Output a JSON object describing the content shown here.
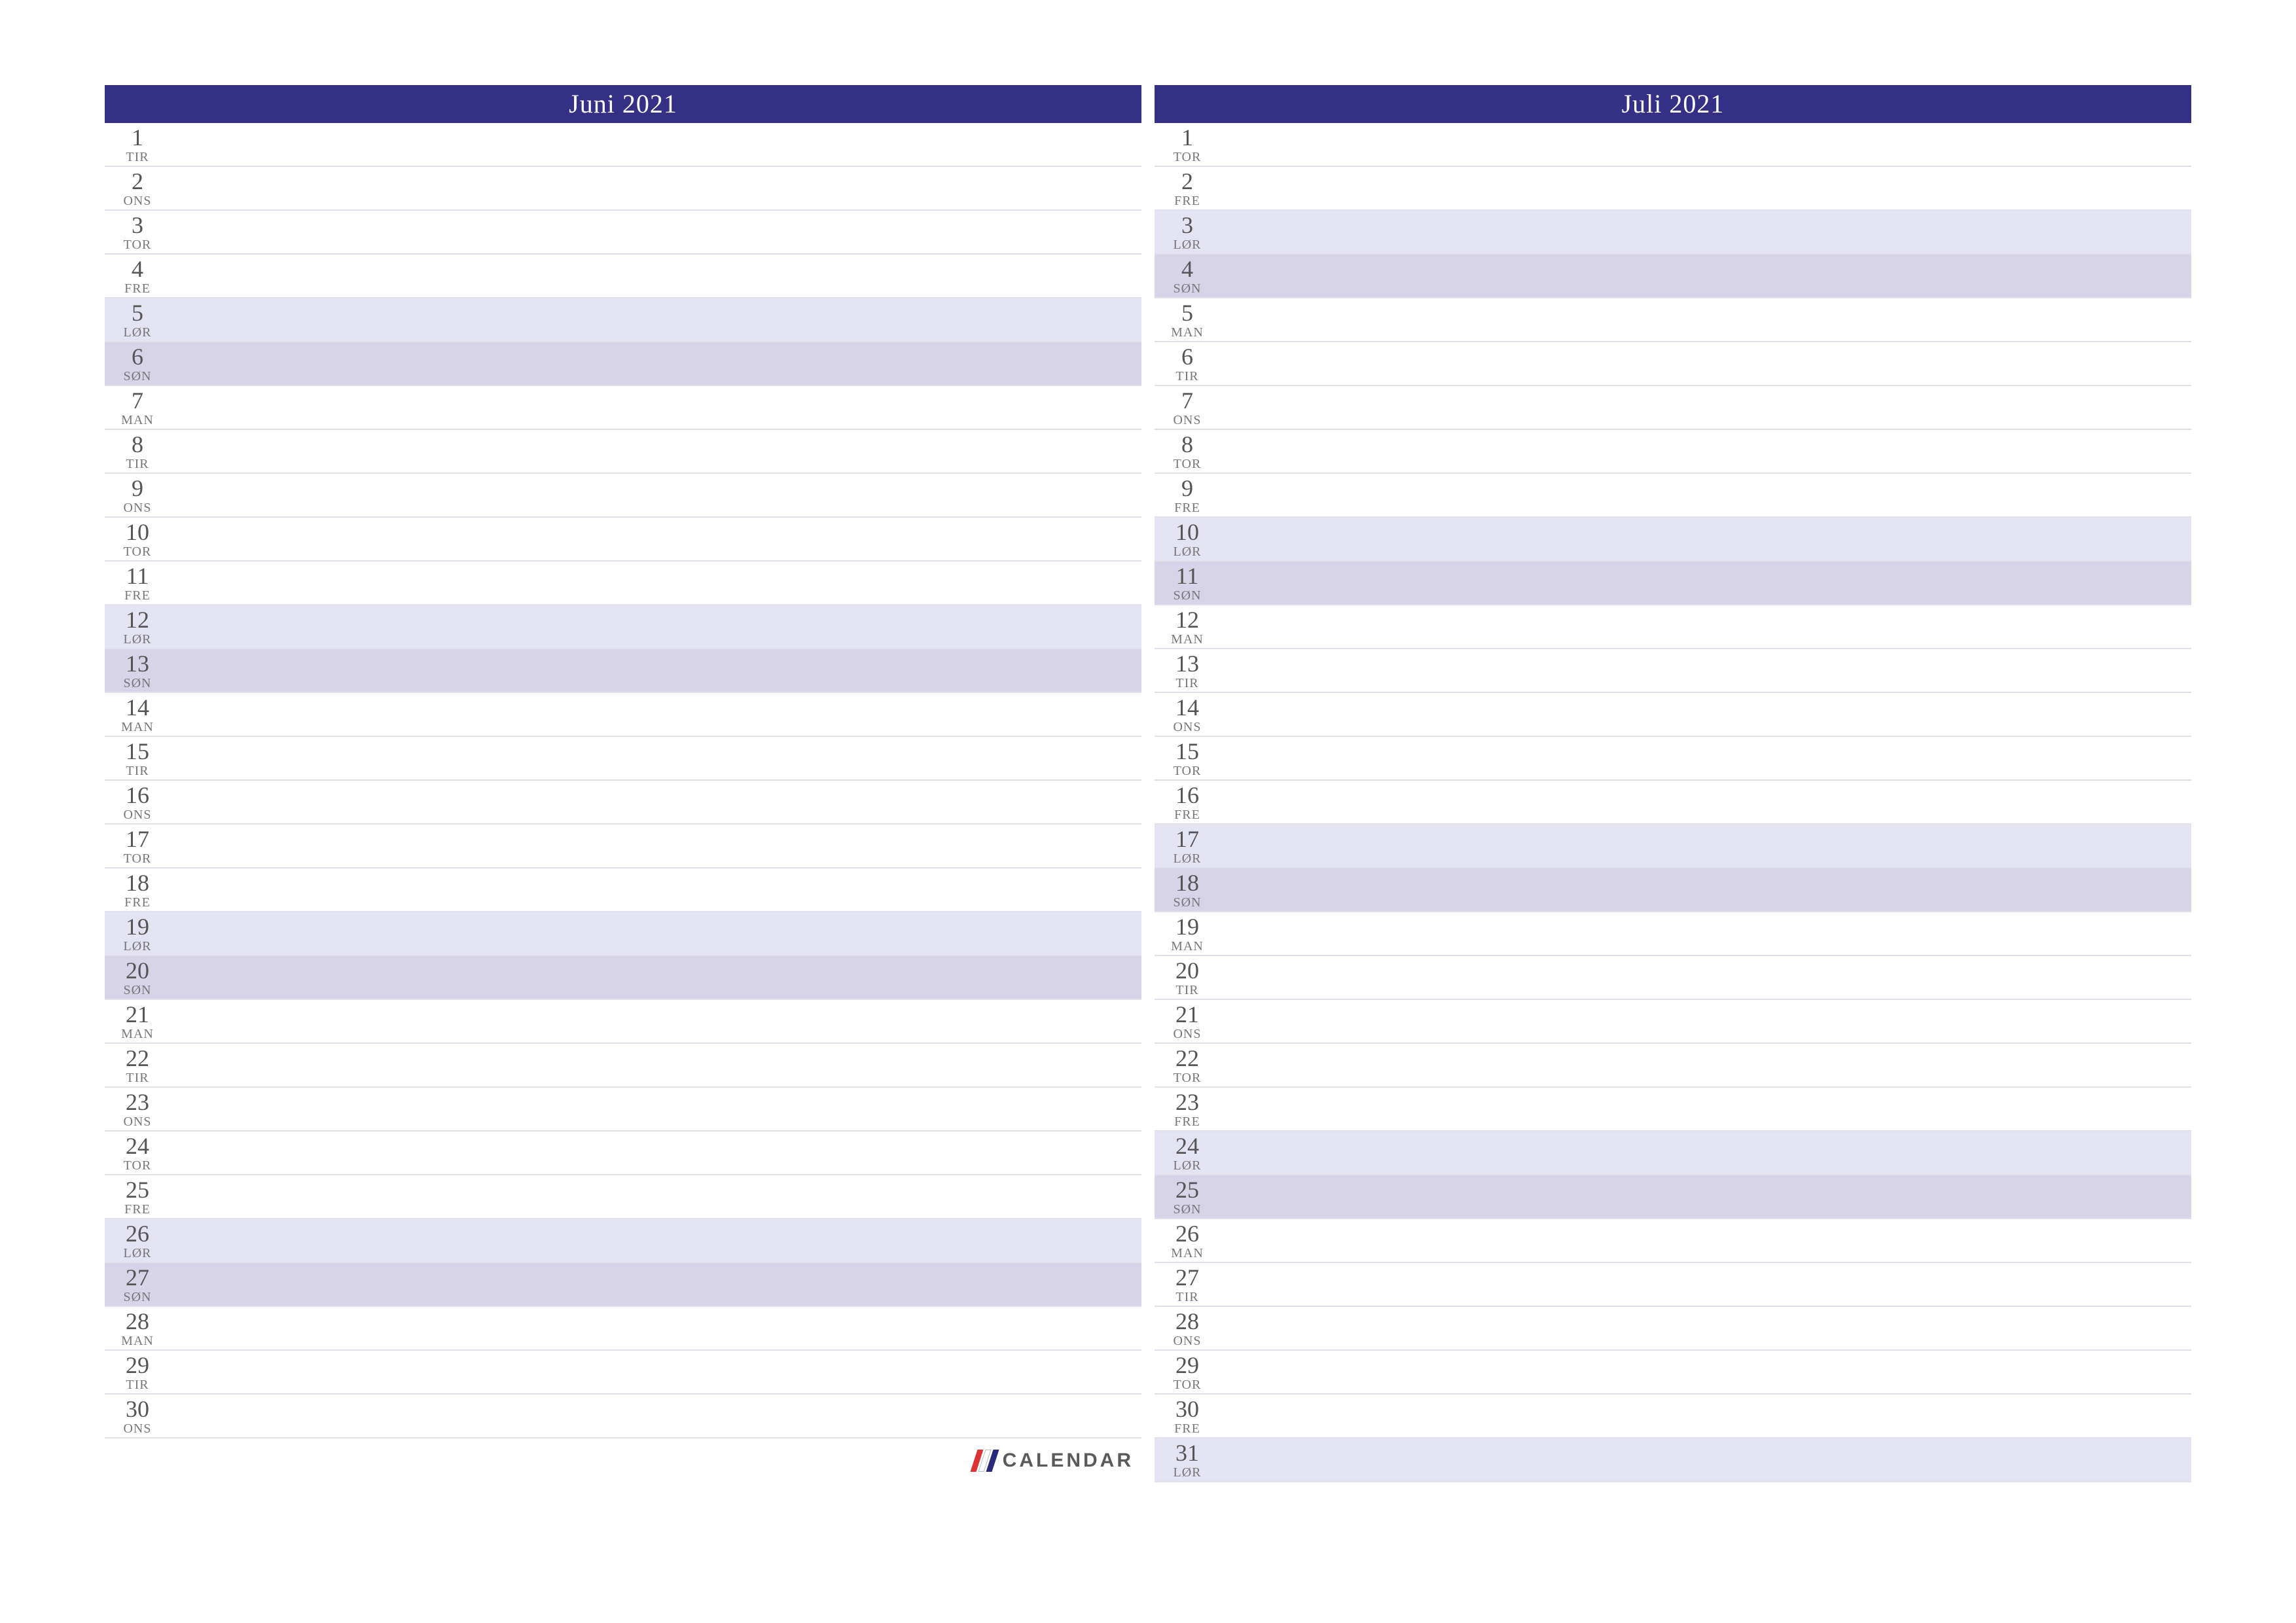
{
  "brand": "CALENDAR",
  "weekday_bg": {
    "MAN": "bg-weekday",
    "TIR": "bg-weekday",
    "ONS": "bg-weekday",
    "TOR": "bg-weekday",
    "FRE": "bg-weekday",
    "LØR": "bg-sat",
    "SØN": "bg-sun"
  },
  "months": [
    {
      "title": "Juni 2021",
      "show_brand": true,
      "days": [
        {
          "n": "1",
          "w": "TIR"
        },
        {
          "n": "2",
          "w": "ONS"
        },
        {
          "n": "3",
          "w": "TOR"
        },
        {
          "n": "4",
          "w": "FRE"
        },
        {
          "n": "5",
          "w": "LØR"
        },
        {
          "n": "6",
          "w": "SØN"
        },
        {
          "n": "7",
          "w": "MAN"
        },
        {
          "n": "8",
          "w": "TIR"
        },
        {
          "n": "9",
          "w": "ONS"
        },
        {
          "n": "10",
          "w": "TOR"
        },
        {
          "n": "11",
          "w": "FRE"
        },
        {
          "n": "12",
          "w": "LØR"
        },
        {
          "n": "13",
          "w": "SØN"
        },
        {
          "n": "14",
          "w": "MAN"
        },
        {
          "n": "15",
          "w": "TIR"
        },
        {
          "n": "16",
          "w": "ONS"
        },
        {
          "n": "17",
          "w": "TOR"
        },
        {
          "n": "18",
          "w": "FRE"
        },
        {
          "n": "19",
          "w": "LØR"
        },
        {
          "n": "20",
          "w": "SØN"
        },
        {
          "n": "21",
          "w": "MAN"
        },
        {
          "n": "22",
          "w": "TIR"
        },
        {
          "n": "23",
          "w": "ONS"
        },
        {
          "n": "24",
          "w": "TOR"
        },
        {
          "n": "25",
          "w": "FRE"
        },
        {
          "n": "26",
          "w": "LØR"
        },
        {
          "n": "27",
          "w": "SØN"
        },
        {
          "n": "28",
          "w": "MAN"
        },
        {
          "n": "29",
          "w": "TIR"
        },
        {
          "n": "30",
          "w": "ONS"
        }
      ]
    },
    {
      "title": "Juli 2021",
      "show_brand": false,
      "days": [
        {
          "n": "1",
          "w": "TOR"
        },
        {
          "n": "2",
          "w": "FRE"
        },
        {
          "n": "3",
          "w": "LØR"
        },
        {
          "n": "4",
          "w": "SØN"
        },
        {
          "n": "5",
          "w": "MAN"
        },
        {
          "n": "6",
          "w": "TIR"
        },
        {
          "n": "7",
          "w": "ONS"
        },
        {
          "n": "8",
          "w": "TOR"
        },
        {
          "n": "9",
          "w": "FRE"
        },
        {
          "n": "10",
          "w": "LØR"
        },
        {
          "n": "11",
          "w": "SØN"
        },
        {
          "n": "12",
          "w": "MAN"
        },
        {
          "n": "13",
          "w": "TIR"
        },
        {
          "n": "14",
          "w": "ONS"
        },
        {
          "n": "15",
          "w": "TOR"
        },
        {
          "n": "16",
          "w": "FRE"
        },
        {
          "n": "17",
          "w": "LØR"
        },
        {
          "n": "18",
          "w": "SØN"
        },
        {
          "n": "19",
          "w": "MAN"
        },
        {
          "n": "20",
          "w": "TIR"
        },
        {
          "n": "21",
          "w": "ONS"
        },
        {
          "n": "22",
          "w": "TOR"
        },
        {
          "n": "23",
          "w": "FRE"
        },
        {
          "n": "24",
          "w": "LØR"
        },
        {
          "n": "25",
          "w": "SØN"
        },
        {
          "n": "26",
          "w": "MAN"
        },
        {
          "n": "27",
          "w": "TIR"
        },
        {
          "n": "28",
          "w": "ONS"
        },
        {
          "n": "29",
          "w": "TOR"
        },
        {
          "n": "30",
          "w": "FRE"
        },
        {
          "n": "31",
          "w": "LØR"
        }
      ]
    }
  ]
}
